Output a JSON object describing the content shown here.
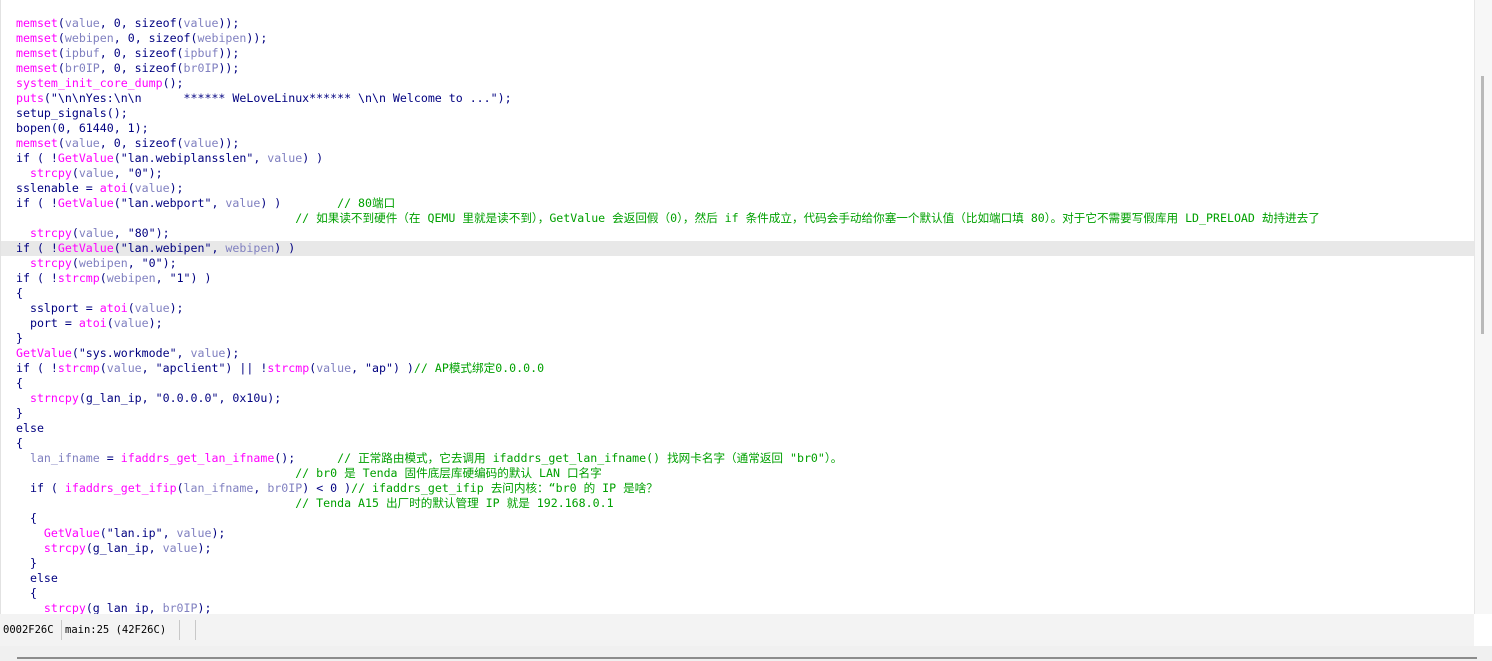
{
  "code": {
    "highlighted_line_index": 15,
    "lines": [
      [
        {
          "t": "memset",
          "c": "fn"
        },
        {
          "t": "(",
          "c": "plain"
        },
        {
          "t": "value",
          "c": "var"
        },
        {
          "t": ", 0, sizeof(",
          "c": "plain"
        },
        {
          "t": "value",
          "c": "var"
        },
        {
          "t": "));",
          "c": "plain"
        }
      ],
      [
        {
          "t": "memset",
          "c": "fn"
        },
        {
          "t": "(",
          "c": "plain"
        },
        {
          "t": "webipen",
          "c": "var"
        },
        {
          "t": ", 0, sizeof(",
          "c": "plain"
        },
        {
          "t": "webipen",
          "c": "var"
        },
        {
          "t": "));",
          "c": "plain"
        }
      ],
      [
        {
          "t": "memset",
          "c": "fn"
        },
        {
          "t": "(",
          "c": "plain"
        },
        {
          "t": "ipbuf",
          "c": "var"
        },
        {
          "t": ", 0, sizeof(",
          "c": "plain"
        },
        {
          "t": "ipbuf",
          "c": "var"
        },
        {
          "t": "));",
          "c": "plain"
        }
      ],
      [
        {
          "t": "memset",
          "c": "fn"
        },
        {
          "t": "(",
          "c": "plain"
        },
        {
          "t": "br0IP",
          "c": "var"
        },
        {
          "t": ", 0, sizeof(",
          "c": "plain"
        },
        {
          "t": "br0IP",
          "c": "var"
        },
        {
          "t": "));",
          "c": "plain"
        }
      ],
      [
        {
          "t": "system_init_core_dump",
          "c": "fn"
        },
        {
          "t": "();",
          "c": "plain"
        }
      ],
      [
        {
          "t": "puts",
          "c": "fn"
        },
        {
          "t": "(\"\\n\\nYes:\\n\\n      ****** WeLoveLinux****** \\n\\n Welcome to ...\");",
          "c": "str"
        }
      ],
      [
        {
          "t": "setup_signals();",
          "c": "plain"
        }
      ],
      [
        {
          "t": "bopen(0, 61440, 1);",
          "c": "plain"
        }
      ],
      [
        {
          "t": "memset",
          "c": "fn"
        },
        {
          "t": "(",
          "c": "plain"
        },
        {
          "t": "value",
          "c": "var"
        },
        {
          "t": ", 0, sizeof(",
          "c": "plain"
        },
        {
          "t": "value",
          "c": "var"
        },
        {
          "t": "));",
          "c": "plain"
        }
      ],
      [
        {
          "t": "if ( !",
          "c": "plain"
        },
        {
          "t": "GetValue",
          "c": "fn"
        },
        {
          "t": "(\"lan.webiplansslen\", ",
          "c": "str"
        },
        {
          "t": "value",
          "c": "var"
        },
        {
          "t": ") )",
          "c": "plain"
        }
      ],
      [
        {
          "t": "  ",
          "c": "plain"
        },
        {
          "t": "strcpy",
          "c": "fn"
        },
        {
          "t": "(",
          "c": "plain"
        },
        {
          "t": "value",
          "c": "var"
        },
        {
          "t": ", \"0\");",
          "c": "str"
        }
      ],
      [
        {
          "t": "sslenable = ",
          "c": "plain"
        },
        {
          "t": "atoi",
          "c": "fn"
        },
        {
          "t": "(",
          "c": "plain"
        },
        {
          "t": "value",
          "c": "var"
        },
        {
          "t": ");",
          "c": "plain"
        }
      ],
      [
        {
          "t": "if ( !",
          "c": "plain"
        },
        {
          "t": "GetValue",
          "c": "fn"
        },
        {
          "t": "(\"lan.webport\", ",
          "c": "str"
        },
        {
          "t": "value",
          "c": "var"
        },
        {
          "t": ") )        ",
          "c": "plain"
        },
        {
          "t": "// 80端口",
          "c": "cmt"
        }
      ],
      [
        {
          "t": "                                        ",
          "c": "plain"
        },
        {
          "t": "// 如果读不到硬件（在 QEMU 里就是读不到），GetValue 会返回假（0），然后 if 条件成立，代码会手动给你塞一个默认值（比如端口填 80）。对于它不需要写假库用 LD_PRELOAD 劫持进去了",
          "c": "cmt"
        }
      ],
      [
        {
          "t": "  ",
          "c": "plain"
        },
        {
          "t": "strcpy",
          "c": "fn"
        },
        {
          "t": "(",
          "c": "plain"
        },
        {
          "t": "value",
          "c": "var"
        },
        {
          "t": ", \"80\");",
          "c": "str"
        }
      ],
      [
        {
          "t": "if ( !",
          "c": "plain"
        },
        {
          "t": "GetValue",
          "c": "fn"
        },
        {
          "t": "(\"lan.webipen\", ",
          "c": "str"
        },
        {
          "t": "webipen",
          "c": "var"
        },
        {
          "t": ") )",
          "c": "plain"
        }
      ],
      [
        {
          "t": "  ",
          "c": "plain"
        },
        {
          "t": "strcpy",
          "c": "fn"
        },
        {
          "t": "(",
          "c": "plain"
        },
        {
          "t": "webipen",
          "c": "var"
        },
        {
          "t": ", \"0\");",
          "c": "str"
        }
      ],
      [
        {
          "t": "if ( !",
          "c": "plain"
        },
        {
          "t": "strcmp",
          "c": "fn"
        },
        {
          "t": "(",
          "c": "plain"
        },
        {
          "t": "webipen",
          "c": "var"
        },
        {
          "t": ", \"1\") )",
          "c": "str"
        }
      ],
      [
        {
          "t": "{",
          "c": "plain"
        }
      ],
      [
        {
          "t": "  sslport = ",
          "c": "plain"
        },
        {
          "t": "atoi",
          "c": "fn"
        },
        {
          "t": "(",
          "c": "plain"
        },
        {
          "t": "value",
          "c": "var"
        },
        {
          "t": ");",
          "c": "plain"
        }
      ],
      [
        {
          "t": "  port = ",
          "c": "plain"
        },
        {
          "t": "atoi",
          "c": "fn"
        },
        {
          "t": "(",
          "c": "plain"
        },
        {
          "t": "value",
          "c": "var"
        },
        {
          "t": ");",
          "c": "plain"
        }
      ],
      [
        {
          "t": "}",
          "c": "plain"
        }
      ],
      [
        {
          "t": "GetValue",
          "c": "fn"
        },
        {
          "t": "(\"sys.workmode\", ",
          "c": "str"
        },
        {
          "t": "value",
          "c": "var"
        },
        {
          "t": ");",
          "c": "plain"
        }
      ],
      [
        {
          "t": "if ( !",
          "c": "plain"
        },
        {
          "t": "strcmp",
          "c": "fn"
        },
        {
          "t": "(",
          "c": "plain"
        },
        {
          "t": "value",
          "c": "var"
        },
        {
          "t": ", \"apclient\") || !",
          "c": "str"
        },
        {
          "t": "strcmp",
          "c": "fn"
        },
        {
          "t": "(",
          "c": "plain"
        },
        {
          "t": "value",
          "c": "var"
        },
        {
          "t": ", \"ap\") )",
          "c": "str"
        },
        {
          "t": "// AP模式绑定0.0.0.0",
          "c": "cmt"
        }
      ],
      [
        {
          "t": "{",
          "c": "plain"
        }
      ],
      [
        {
          "t": "  ",
          "c": "plain"
        },
        {
          "t": "strncpy",
          "c": "fn"
        },
        {
          "t": "(g_lan_ip, \"0.0.0.0\", 0x10u);",
          "c": "str"
        }
      ],
      [
        {
          "t": "}",
          "c": "plain"
        }
      ],
      [
        {
          "t": "else",
          "c": "plain"
        }
      ],
      [
        {
          "t": "{",
          "c": "plain"
        }
      ],
      [
        {
          "t": "  ",
          "c": "plain"
        },
        {
          "t": "lan_ifname",
          "c": "var"
        },
        {
          "t": " = ",
          "c": "plain"
        },
        {
          "t": "ifaddrs_get_lan_ifname",
          "c": "fn"
        },
        {
          "t": "();      ",
          "c": "plain"
        },
        {
          "t": "// 正常路由模式，它去调用 ifaddrs_get_lan_ifname() 找网卡名字（通常返回 \"br0\"）。",
          "c": "cmt"
        }
      ],
      [
        {
          "t": "                                        ",
          "c": "plain"
        },
        {
          "t": "// br0 是 Tenda 固件底层库硬编码的默认 LAN 口名字",
          "c": "cmt"
        }
      ],
      [
        {
          "t": "  if ( ",
          "c": "plain"
        },
        {
          "t": "ifaddrs_get_ifip",
          "c": "fn"
        },
        {
          "t": "(",
          "c": "plain"
        },
        {
          "t": "lan_ifname",
          "c": "var"
        },
        {
          "t": ", ",
          "c": "plain"
        },
        {
          "t": "br0IP",
          "c": "var"
        },
        {
          "t": ") < 0 )",
          "c": "plain"
        },
        {
          "t": "// ifaddrs_get_ifip 去问内核：“br0 的 IP 是啥？",
          "c": "cmt"
        }
      ],
      [
        {
          "t": "                                        ",
          "c": "plain"
        },
        {
          "t": "// Tenda A15 出厂时的默认管理 IP 就是 192.168.0.1",
          "c": "cmt"
        }
      ],
      [
        {
          "t": "  {",
          "c": "plain"
        }
      ],
      [
        {
          "t": "    ",
          "c": "plain"
        },
        {
          "t": "GetValue",
          "c": "fn"
        },
        {
          "t": "(\"lan.ip\", ",
          "c": "str"
        },
        {
          "t": "value",
          "c": "var"
        },
        {
          "t": ");",
          "c": "plain"
        }
      ],
      [
        {
          "t": "    ",
          "c": "plain"
        },
        {
          "t": "strcpy",
          "c": "fn"
        },
        {
          "t": "(g_lan_ip, ",
          "c": "str"
        },
        {
          "t": "value",
          "c": "var"
        },
        {
          "t": ");",
          "c": "plain"
        }
      ],
      [
        {
          "t": "  }",
          "c": "plain"
        }
      ],
      [
        {
          "t": "  else",
          "c": "plain"
        }
      ],
      [
        {
          "t": "  {",
          "c": "plain"
        }
      ],
      [
        {
          "t": "    ",
          "c": "plain"
        },
        {
          "t": "strcpy",
          "c": "fn"
        },
        {
          "t": "(g_lan_ip, ",
          "c": "str"
        },
        {
          "t": "br0IP",
          "c": "var"
        },
        {
          "t": ");",
          "c": "plain"
        }
      ]
    ]
  },
  "status": {
    "offset": "0002F26C",
    "location": "main:25 (42F26C)"
  }
}
